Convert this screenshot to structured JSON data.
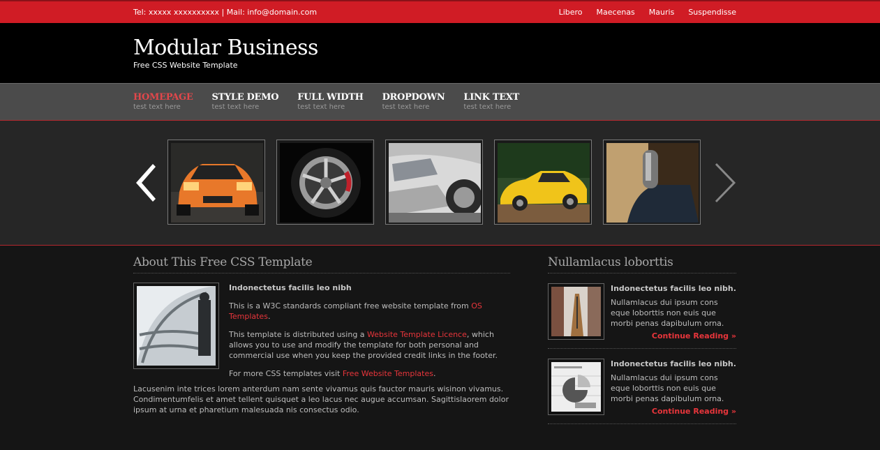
{
  "topbar": {
    "contact": "Tel: xxxxx xxxxxxxxxx | Mail: info@domain.com",
    "links": [
      "Libero",
      "Maecenas",
      "Mauris",
      "Suspendisse"
    ]
  },
  "header": {
    "title": "Modular Business",
    "subtitle": "Free CSS Website Template"
  },
  "nav": [
    {
      "label": "HOMEPAGE",
      "sub": "test text here"
    },
    {
      "label": "STYLE DEMO",
      "sub": "test text here"
    },
    {
      "label": "FULL WIDTH",
      "sub": "test text here"
    },
    {
      "label": "DROPDOWN",
      "sub": "test text here"
    },
    {
      "label": "LINK TEXT",
      "sub": "test text here"
    }
  ],
  "gallery": {
    "images": [
      "orange-sports-car",
      "alloy-wheel",
      "silver-car-headlight",
      "yellow-sports-car",
      "gear-stick"
    ]
  },
  "main": {
    "heading": "About This Free CSS Template",
    "article_title": "Indonectetus facilis leo nibh",
    "p1_text": "This is a W3C standards compliant free website template from ",
    "p1_link": "OS Templates",
    "p1_end": ".",
    "p2_text": "This template is distributed using a ",
    "p2_link": "Website Template Licence",
    "p2_end": ", which allows you to use and modify the template for both personal and commercial use when you keep the provided credit links in the footer.",
    "p3_text": "For more CSS templates visit ",
    "p3_link": "Free Website Templates",
    "p3_end": ".",
    "p4": "Lacusenim inte trices lorem anterdum nam sente vivamus quis fauctor mauris wisinon vivamus. Condimentumfelis et amet tellent quisquet a leo lacus nec augue accumsan. Sagittislaorem dolor ipsum at urna et pharetium malesuada nis consectus odio."
  },
  "sidebar": {
    "heading": "Nullamlacus loborttis",
    "items": [
      {
        "title": "Indonectetus facilis leo nibh.",
        "text": "Nullamlacus dui ipsum cons eque loborttis non euis que morbi penas dapibulum orna.",
        "more": "Continue Reading »"
      },
      {
        "title": "Indonectetus facilis leo nibh.",
        "text": "Nullamlacus dui ipsum cons eque loborttis non euis que morbi penas dapibulum orna.",
        "more": "Continue Reading »"
      }
    ]
  },
  "colors": {
    "accent_red": "#d01c25",
    "link_red": "#e8353b",
    "nav_bg": "#4b4b4b",
    "header_bg": "#000000"
  }
}
